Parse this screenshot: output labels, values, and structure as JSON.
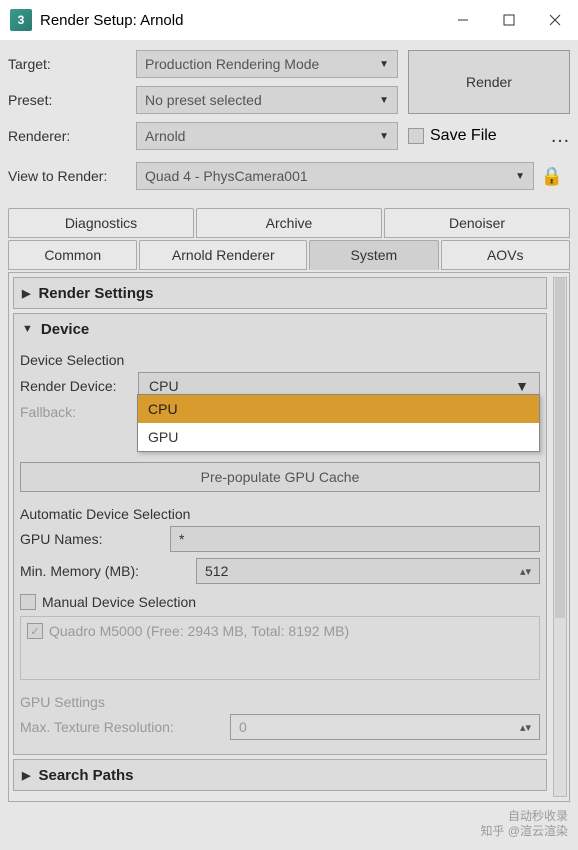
{
  "window": {
    "title": "Render Setup: Arnold",
    "app_icon_text": "3"
  },
  "form": {
    "target_label": "Target:",
    "target_value": "Production Rendering Mode",
    "preset_label": "Preset:",
    "preset_value": "No preset selected",
    "renderer_label": "Renderer:",
    "renderer_value": "Arnold",
    "save_file_label": "Save File",
    "view_label": "View to Render:",
    "view_value": "Quad 4 - PhysCamera001",
    "render_button": "Render"
  },
  "tabs_row1": [
    "Diagnostics",
    "Archive",
    "Denoiser"
  ],
  "tabs_row2": [
    "Common",
    "Arnold Renderer",
    "System",
    "AOVs"
  ],
  "active_tab": "System",
  "sections": {
    "render_settings": {
      "title": "Render Settings"
    },
    "device": {
      "title": "Device",
      "device_selection_label": "Device Selection",
      "render_device_label": "Render Device:",
      "render_device_value": "CPU",
      "options": [
        "CPU",
        "GPU"
      ],
      "fallback_label": "Fallback:",
      "prepop_button": "Pre-populate GPU Cache",
      "auto_label": "Automatic Device Selection",
      "gpu_names_label": "GPU Names:",
      "gpu_names_value": "*",
      "min_memory_label": "Min. Memory (MB):",
      "min_memory_value": "512",
      "manual_label": "Manual Device Selection",
      "manual_item": "Quadro M5000 (Free: 2943 MB, Total: 8192 MB)",
      "gpu_settings_label": "GPU Settings",
      "max_texture_label": "Max. Texture Resolution:",
      "max_texture_value": "0"
    },
    "search_paths": {
      "title": "Search Paths"
    }
  },
  "watermark": {
    "line1": "自动秒收录",
    "line2": "知乎 @渲云渲染"
  }
}
